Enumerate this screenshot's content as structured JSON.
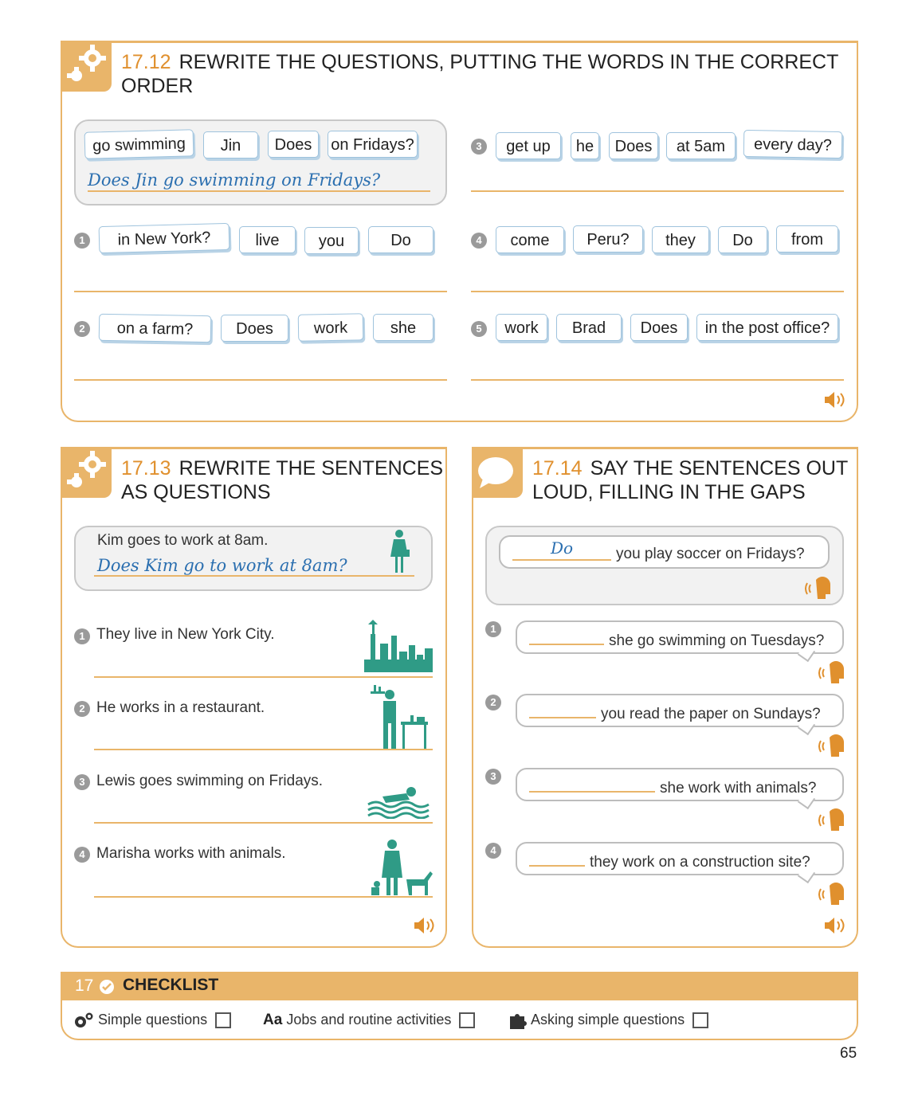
{
  "ex1712": {
    "number": "17.12",
    "title": "REWRITE THE QUESTIONS, PUTTING THE WORDS IN THE CORRECT ORDER",
    "example": {
      "tiles": [
        "go swimming",
        "Jin",
        "Does",
        "on Fridays?"
      ],
      "answer": "Does Jin go swimming on Fridays?"
    },
    "items": [
      {
        "n": "1",
        "tiles": [
          "in New York?",
          "live",
          "you",
          "Do"
        ]
      },
      {
        "n": "2",
        "tiles": [
          "on a farm?",
          "Does",
          "work",
          "she"
        ]
      },
      {
        "n": "3",
        "tiles": [
          "get up",
          "he",
          "Does",
          "at 5am",
          "every day?"
        ]
      },
      {
        "n": "4",
        "tiles": [
          "come",
          "Peru?",
          "they",
          "Do",
          "from"
        ]
      },
      {
        "n": "5",
        "tiles": [
          "work",
          "Brad",
          "Does",
          "in the post office?"
        ]
      }
    ]
  },
  "ex1713": {
    "number": "17.13",
    "title_line1": "REWRITE THE SENTENCES",
    "title_line2": "AS QUESTIONS",
    "example": {
      "sentence": "Kim goes to work at 8am.",
      "answer": "Does Kim go to work at 8am?"
    },
    "items": [
      {
        "n": "1",
        "sentence": "They live in New York City."
      },
      {
        "n": "2",
        "sentence": "He works in a restaurant."
      },
      {
        "n": "3",
        "sentence": "Lewis goes swimming on Fridays."
      },
      {
        "n": "4",
        "sentence": "Marisha works with animals."
      }
    ]
  },
  "ex1714": {
    "number": "17.14",
    "title_line1": "SAY THE SENTENCES OUT",
    "title_line2": "LOUD, FILLING IN THE GAPS",
    "example": {
      "answer": "Do",
      "rest": "you play soccer on Fridays?"
    },
    "items": [
      {
        "n": "1",
        "rest": "she go swimming on Tuesdays?"
      },
      {
        "n": "2",
        "rest": "you read the paper on Sundays?"
      },
      {
        "n": "3",
        "rest": "she work with animals?"
      },
      {
        "n": "4",
        "rest": "they work on a construction site?"
      }
    ]
  },
  "checklist": {
    "unit": "17",
    "title": "CHECKLIST",
    "aa_glyph": "Aa",
    "items": [
      "Simple questions",
      "Jobs and routine activities",
      "Asking simple questions"
    ]
  },
  "page_number": "65",
  "colors": {
    "accent": "#e9b56a",
    "accent_dark": "#e0902e",
    "handwriting": "#2b6fb0",
    "illustration": "#2f9b86"
  }
}
